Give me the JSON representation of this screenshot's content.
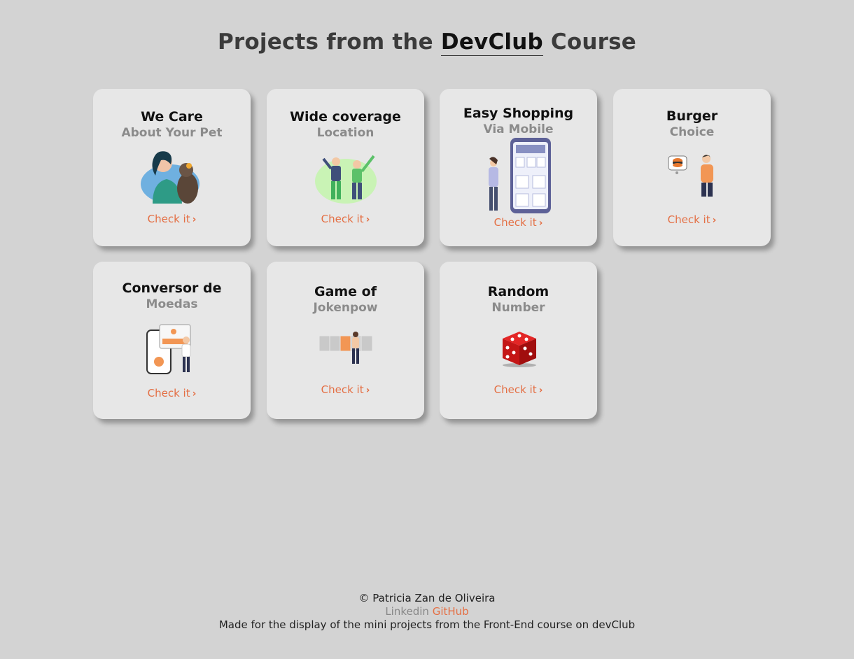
{
  "header": {
    "title_prefix": "Projects from the",
    "title_brand": "DevClub",
    "title_suffix": "Course"
  },
  "cards": [
    {
      "title": "We Care",
      "subtitle": "About Your Pet",
      "link": "Check it",
      "icon": "woman-with-dog-illustration"
    },
    {
      "title": "Wide coverage",
      "subtitle": "Location",
      "link": "Check it",
      "icon": "people-celebrating-illustration"
    },
    {
      "title": "Easy Shopping",
      "subtitle": "Via Mobile",
      "link": "Check it",
      "icon": "woman-with-phone-illustration"
    },
    {
      "title": "Burger",
      "subtitle": "Choice",
      "link": "Check it",
      "icon": "man-eating-burger-illustration"
    },
    {
      "title": "Conversor de",
      "subtitle": "Moedas",
      "link": "Check it",
      "icon": "currency-converter-illustration"
    },
    {
      "title": "Game of",
      "subtitle": "Jokenpow",
      "link": "Check it",
      "icon": "game-blocks-illustration"
    },
    {
      "title": "Random",
      "subtitle": "Number",
      "link": "Check it",
      "icon": "red-dice-icon"
    }
  ],
  "footer": {
    "copyright": "© Patricia Zan de Oliveira",
    "linkedin": "Linkedin",
    "github": "GitHub",
    "note": "Made for the display of the mini projects from the Front-End course on devClub"
  },
  "colors": {
    "background": "#d3d3d3",
    "card": "#e7e7e7",
    "accent": "#e46f44",
    "subtitle": "#8b8b8b"
  }
}
